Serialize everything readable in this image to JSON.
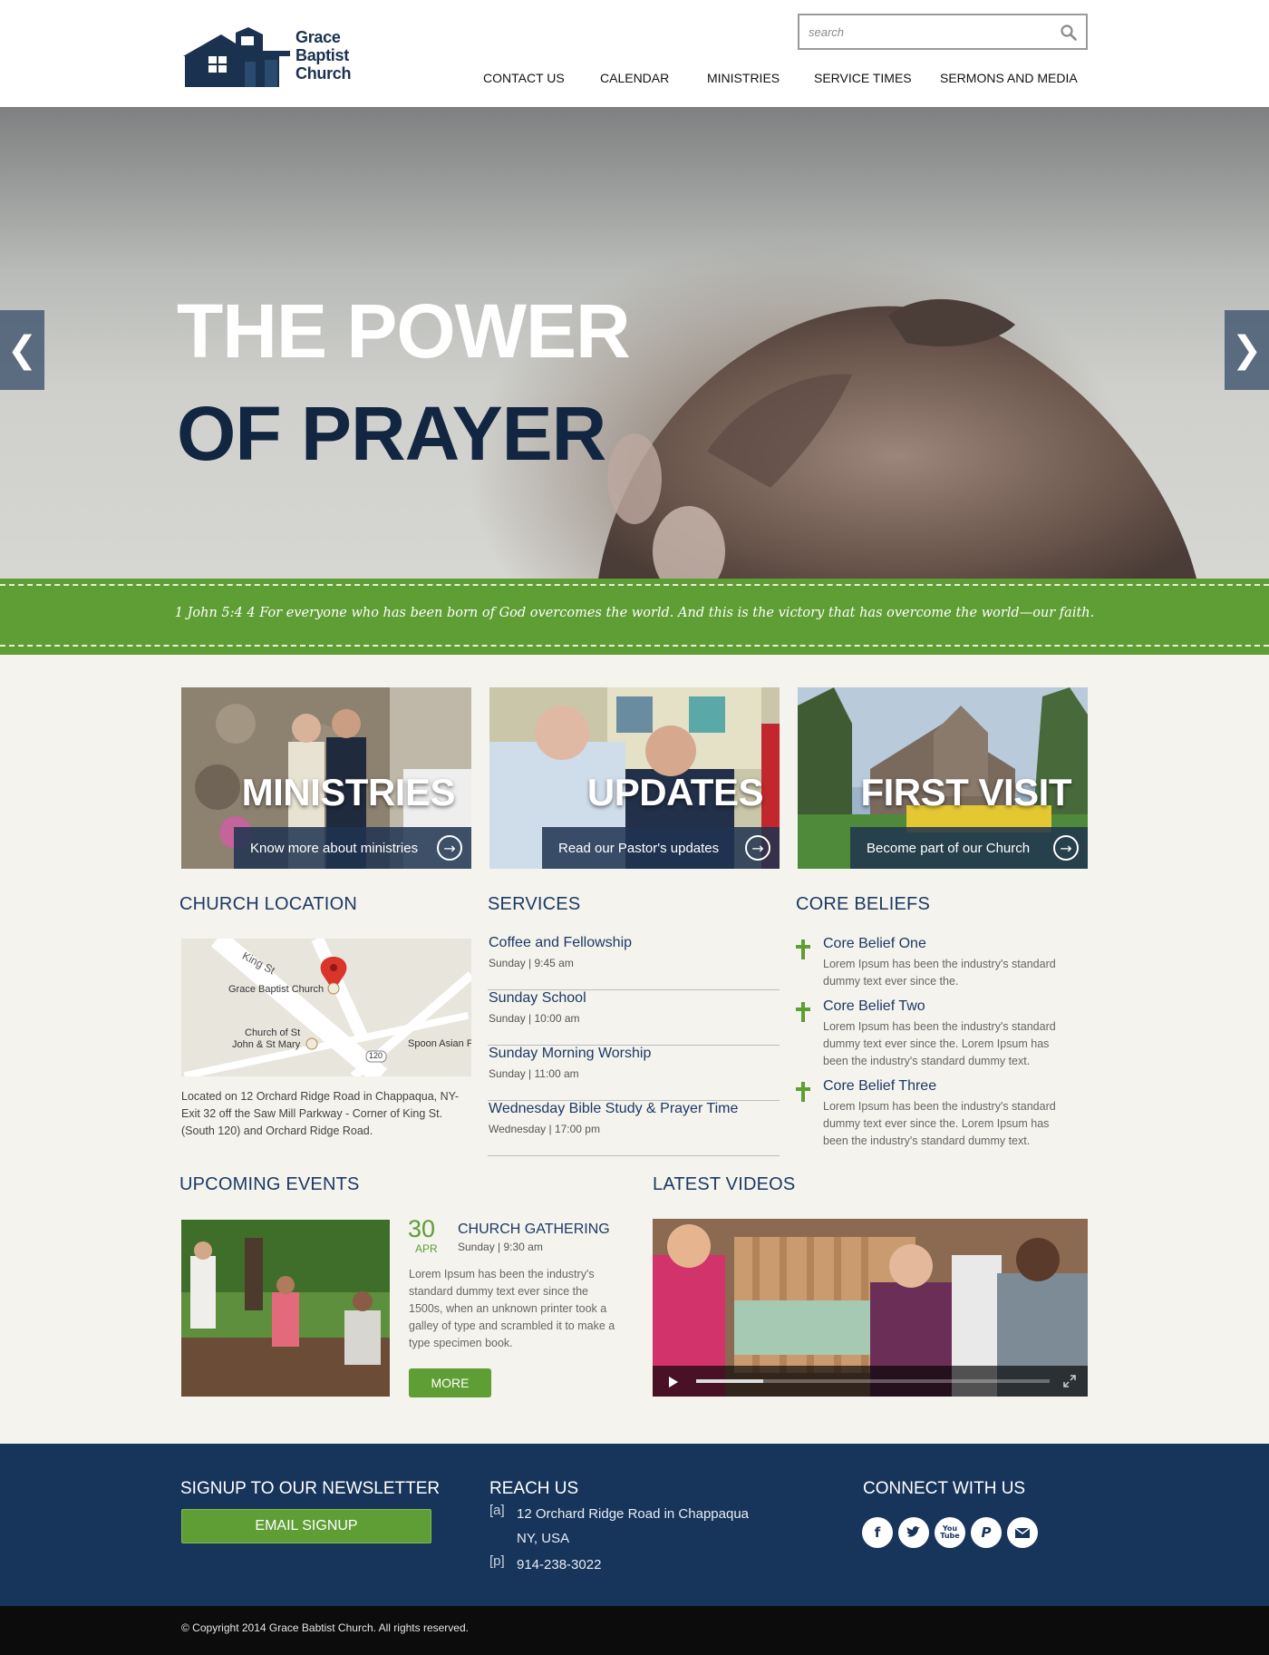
{
  "header": {
    "logo_lines": [
      "Grace",
      "Baptist",
      "Church"
    ],
    "search_placeholder": "search",
    "nav": [
      "CONTACT US",
      "CALENDAR",
      "MINISTRIES",
      "SERVICE TIMES",
      "SERMONS AND MEDIA"
    ]
  },
  "hero": {
    "line1": "THE POWER",
    "line2": "OF PRAYER",
    "prev_arrow": "❮",
    "next_arrow": "❯"
  },
  "verse": "1 John 5:4  4 For everyone who has been born of God overcomes the world. And this is the victory that has overcome the world—our faith.",
  "cards": [
    {
      "title": "MINISTRIES",
      "link": "Know more about ministries"
    },
    {
      "title": "UPDATES",
      "link": "Read our Pastor's updates"
    },
    {
      "title": "FIRST VISIT",
      "link": "Become part of our Church"
    }
  ],
  "location": {
    "heading": "CHURCH LOCATION",
    "map_labels": {
      "street": "King St",
      "church": "Grace Baptist Church",
      "other_church_1": "Church of St",
      "other_church_2": "John & St Mary",
      "route": "120",
      "spoon": "Spoon Asian F"
    },
    "caption": "Located on 12 Orchard Ridge Road in Chappaqua, NY- Exit 32 off the Saw Mill Parkway - Corner of King St. (South 120) and Orchard Ridge Road."
  },
  "services": {
    "heading": "SERVICES",
    "items": [
      {
        "name": "Coffee and Fellowship",
        "time": "Sunday | 9:45 am"
      },
      {
        "name": "Sunday School",
        "time": "Sunday | 10:00 am"
      },
      {
        "name": "Sunday Morning Worship",
        "time": "Sunday | 11:00 am"
      },
      {
        "name": "Wednesday Bible Study & Prayer Time",
        "time": "Wednesday | 17:00 pm"
      }
    ]
  },
  "beliefs": {
    "heading": "CORE BELIEFS",
    "items": [
      {
        "title": "Core Belief One",
        "desc": "Lorem Ipsum has been the industry's standard dummy text ever since the."
      },
      {
        "title": "Core Belief Two",
        "desc": "Lorem Ipsum has been the industry's standard dummy text ever since the. Lorem Ipsum has been the industry's standard dummy text."
      },
      {
        "title": "Core Belief Three",
        "desc": "Lorem Ipsum has been the industry's standard dummy text ever since the. Lorem Ipsum has been the industry's standard dummy text."
      }
    ]
  },
  "events": {
    "heading": "UPCOMING EVENTS",
    "day": "30",
    "month": "APR",
    "title": "CHURCH GATHERING",
    "time": "Sunday | 9:30 am",
    "desc": "Lorem Ipsum has been the industry's standard dummy text ever since the 1500s, when an unknown printer took a galley of type and scrambled it to make a type specimen book.",
    "button": "MORE"
  },
  "videos": {
    "heading": "LATEST VIDEOS",
    "progress": 0.19
  },
  "footer": {
    "newsletter_heading": "SIGNUP TO OUR NEWSLETTER",
    "email_button": "EMAIL SIGNUP",
    "reach_heading": "REACH US",
    "address_key": "[a]",
    "address_line1": "12 Orchard Ridge Road in Chappaqua",
    "address_line2": "NY, USA",
    "phone_key": "[p]",
    "phone": "914-238-3022",
    "connect_heading": "CONNECT WITH US",
    "social": [
      "facebook-icon",
      "twitter-icon",
      "youtube-icon",
      "paypal-icon",
      "email-icon"
    ],
    "youtube_text": "You\nTube",
    "copyright": "© Copyright 2014 Grace Babtist Church. All rights reserved."
  },
  "colors": {
    "navy": "#17345a",
    "green": "#5f9e35",
    "heading_blue": "#1c3a63"
  }
}
